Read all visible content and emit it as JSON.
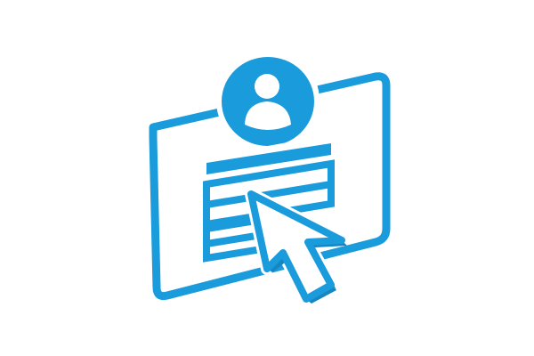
{
  "icon": {
    "name": "user-profile-form-click-icon",
    "parts": [
      "screen-frame-icon",
      "user-avatar-icon",
      "form-lines-icon",
      "mouse-cursor-icon"
    ]
  },
  "colors": {
    "background": "#ffffff",
    "accent": "#1a9bdc",
    "shadow": "#1586bf"
  }
}
